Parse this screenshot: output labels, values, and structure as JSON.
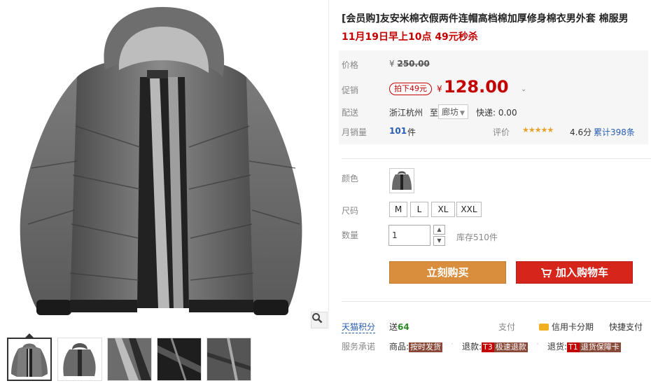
{
  "product": {
    "title": "[会员购]友安米棉衣假两件连帽高档棉加厚修身棉衣男外套 棉服男",
    "subtitle": "11月19日早上10点 49元秒杀"
  },
  "price": {
    "label": "价格",
    "original_symbol": "¥",
    "original_value": "250.00",
    "promo_label": "促销",
    "promo_tag": "拍下49元",
    "current_symbol": "¥",
    "current_value": "128.00"
  },
  "shipping": {
    "label": "配送",
    "from": "浙江杭州",
    "to_word": "至",
    "destination": "廊坊",
    "fee": "快递: 0.00"
  },
  "sales": {
    "label": "月销量",
    "count": "101",
    "unit": "件",
    "rating_label": "评价",
    "stars": 4.6,
    "score": "4.6分",
    "reviews": "累计398条"
  },
  "options": {
    "color_label": "颜色",
    "size_label": "尺码",
    "sizes": [
      "M",
      "L",
      "XL",
      "XXL"
    ],
    "quantity_label": "数量",
    "quantity_value": "1",
    "stock": "库存510件"
  },
  "actions": {
    "buy_now": "立刻购买",
    "add_cart": "加入购物车"
  },
  "extras": {
    "points_label": "天猫积分",
    "points_send": "送",
    "points_value": "64",
    "pay_label": "支付",
    "credit": "信用卡分期",
    "express_pay": "快捷支付",
    "service_label": "服务承诺",
    "service_goods": "商品:",
    "service_goods_badge": "按时发货",
    "service_refund": "退款:",
    "service_refund_t": "T3",
    "service_refund_badge": "极速退款",
    "service_return": "退货:",
    "service_return_t": "T1",
    "service_return_badge": "退货保障卡"
  },
  "icons": {
    "zoom": "magnifier-icon",
    "cart": "cart-icon",
    "card": "credit-card-icon"
  },
  "colors": {
    "price_red": "#c40000",
    "buy_orange": "#d98e3e",
    "cart_red": "#d6261c"
  }
}
